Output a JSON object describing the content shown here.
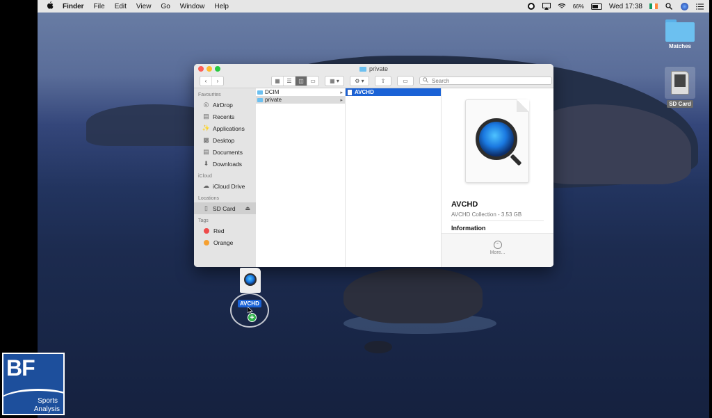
{
  "menubar": {
    "app_name": "Finder",
    "menus": [
      "File",
      "Edit",
      "View",
      "Go",
      "Window",
      "Help"
    ],
    "battery": "66%",
    "clock": "Wed 17:38"
  },
  "desktop": {
    "folder_label": "Matches",
    "drive_label": "SD Card"
  },
  "finder": {
    "title": "private",
    "search_placeholder": "Search",
    "sidebar": {
      "favourites_header": "Favourites",
      "favourites": [
        "AirDrop",
        "Recents",
        "Applications",
        "Desktop",
        "Documents",
        "Downloads"
      ],
      "icloud_header": "iCloud",
      "icloud": [
        "iCloud Drive"
      ],
      "locations_header": "Locations",
      "locations": [
        "SD Card"
      ],
      "tags_header": "Tags",
      "tags": [
        "Red",
        "Orange"
      ]
    },
    "column1": [
      "DCIM",
      "private"
    ],
    "column2": [
      "AVCHD"
    ],
    "preview": {
      "name": "AVCHD",
      "subtitle": "AVCHD Collection - 3.53 GB",
      "info_header": "Information",
      "more_label": "More..."
    }
  },
  "drag": {
    "label": "AVCHD"
  },
  "logo": {
    "brand": "BF",
    "line1": "Sports",
    "line2": "Analysis"
  },
  "colors": {
    "selection_blue": "#1a62d6",
    "tag_red": "#ee4b4b",
    "tag_orange": "#f5a030",
    "logo_blue": "#1d4f9c"
  }
}
